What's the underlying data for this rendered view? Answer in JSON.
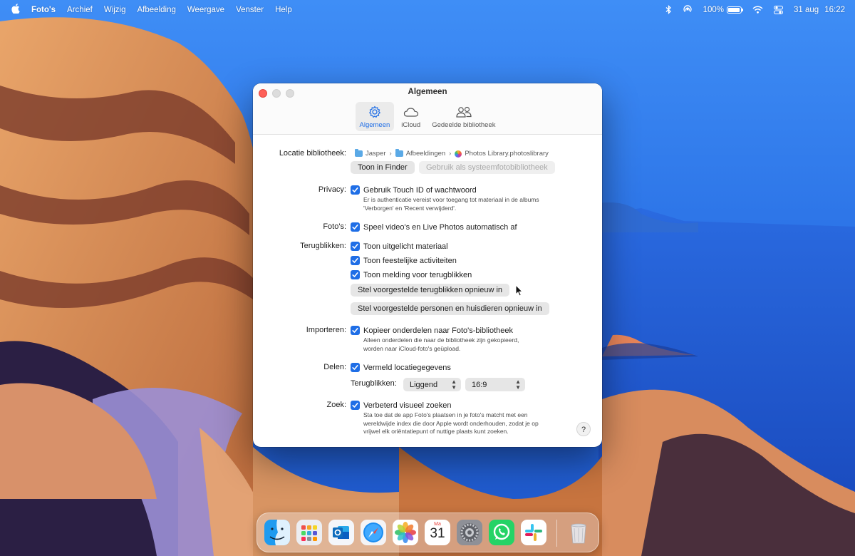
{
  "menubar": {
    "app_name": "Foto's",
    "menus": [
      "Archief",
      "Wijzig",
      "Afbeelding",
      "Weergave",
      "Venster",
      "Help"
    ],
    "battery": "100%",
    "date": "31 aug",
    "time": "16:22"
  },
  "window": {
    "title": "Algemeen",
    "tabs": [
      {
        "label": "Algemeen",
        "icon": "gear-icon",
        "active": true
      },
      {
        "label": "iCloud",
        "icon": "cloud-icon",
        "active": false
      },
      {
        "label": "Gedeelde bibliotheek",
        "icon": "people-icon",
        "active": false
      }
    ]
  },
  "library": {
    "label": "Locatie bibliotheek:",
    "path": [
      "Jasper",
      "Afbeeldingen",
      "Photos Library.photoslibrary"
    ],
    "show_in_finder": "Toon in Finder",
    "use_as_system": "Gebruik als systeemfotobibliotheek"
  },
  "privacy": {
    "label": "Privacy:",
    "checkbox": "Gebruik Touch ID of wachtwoord",
    "checked": true,
    "desc1": "Er is authenticatie vereist voor toegang tot materiaal in de albums",
    "desc2": "'Verborgen' en 'Recent verwijderd'."
  },
  "photos": {
    "label": "Foto's:",
    "checkbox": "Speel video's en Live Photos automatisch af",
    "checked": true
  },
  "memories": {
    "label": "Terugblikken:",
    "checkboxes": [
      {
        "label": "Toon uitgelicht materiaal",
        "checked": true
      },
      {
        "label": "Toon feestelijke activiteiten",
        "checked": true
      },
      {
        "label": "Toon melding voor terugblikken",
        "checked": true
      }
    ],
    "reset_memories": "Stel voorgestelde terugblikken opnieuw in",
    "reset_people": "Stel voorgestelde personen en huisdieren opnieuw in"
  },
  "importing": {
    "label": "Importeren:",
    "checkbox": "Kopieer onderdelen naar Foto's-bibliotheek",
    "checked": true,
    "desc1": "Alleen onderdelen die naar de bibliotheek zijn gekopieerd,",
    "desc2": "worden naar iCloud-foto's geüpload."
  },
  "sharing": {
    "label": "Delen:",
    "checkbox": "Vermeld locatiegegevens",
    "checked": true,
    "memories_label": "Terugblikken:",
    "orientation": "Liggend",
    "aspect": "16:9"
  },
  "search": {
    "label": "Zoek:",
    "checkbox": "Verbeterd visueel zoeken",
    "checked": true,
    "desc1": "Sta toe dat de app Foto's plaatsen in je foto's matcht met een",
    "desc2": "wereldwijde index die door Apple wordt onderhouden, zodat je op",
    "desc3": "vrijwel elk oriëntatiepunt of nuttige plaats kunt zoeken."
  },
  "help_label": "?",
  "dock": {
    "apps": [
      "finder",
      "launchpad",
      "outlook",
      "safari",
      "photos",
      "calendar",
      "system-settings",
      "whatsapp",
      "slack",
      "trash"
    ],
    "calendar_month": "Ma",
    "calendar_day": "31"
  },
  "colors": {
    "accent": "#1f6ee6",
    "close_button": "#fe5f57",
    "sea": "#1f5fd0"
  }
}
